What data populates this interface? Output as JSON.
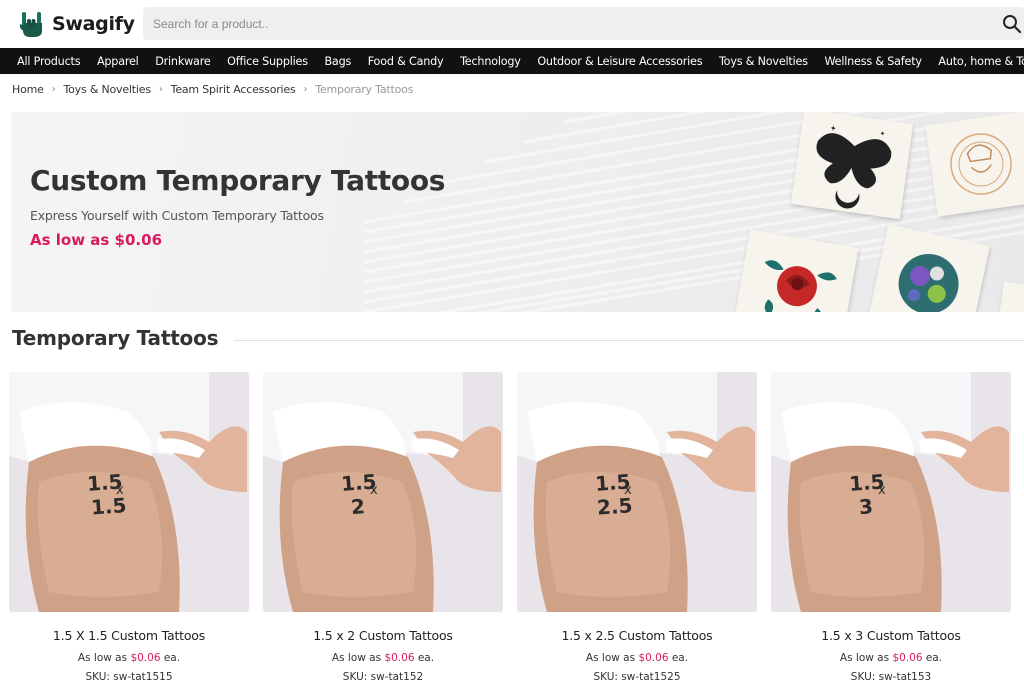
{
  "brand": {
    "name": "Swagify",
    "logo_icon": "hand-horns-icon"
  },
  "search": {
    "placeholder": "Search for a product..",
    "icon": "search-icon"
  },
  "nav": {
    "items": [
      "All Products",
      "Apparel",
      "Drinkware",
      "Office Supplies",
      "Bags",
      "Food & Candy",
      "Technology",
      "Outdoor & Leisure Accessories",
      "Toys & Novelties",
      "Wellness & Safety",
      "Auto, home & Tools"
    ]
  },
  "breadcrumb": {
    "items": [
      "Home",
      "Toys & Novelties",
      "Team Spirit Accessories"
    ],
    "current": "Temporary Tattoos",
    "separator": "›"
  },
  "hero": {
    "title": "Custom Temporary Tattoos",
    "subtitle": "Express Yourself with Custom Temporary Tattoos",
    "price": "As low as $0.06"
  },
  "section": {
    "title": "Temporary Tattoos"
  },
  "products": [
    {
      "name": "1.5 X 1.5 Custom Tattoos",
      "price_prefix": "As low as",
      "price": "$0.06",
      "price_suffix": "ea.",
      "sku": "SKU: sw-tat1515",
      "tattoo_top": "1.5",
      "tattoo_x": "x",
      "tattoo_bottom": "1.5"
    },
    {
      "name": "1.5 x 2 Custom Tattoos",
      "price_prefix": "As low as",
      "price": "$0.06",
      "price_suffix": "ea.",
      "sku": "SKU: sw-tat152",
      "tattoo_top": "1.5",
      "tattoo_x": "x",
      "tattoo_bottom": "2"
    },
    {
      "name": "1.5 x 2.5 Custom Tattoos",
      "price_prefix": "As low as",
      "price": "$0.06",
      "price_suffix": "ea.",
      "sku": "SKU: sw-tat1525",
      "tattoo_top": "1.5",
      "tattoo_x": "x",
      "tattoo_bottom": "2.5"
    },
    {
      "name": "1.5 x 3 Custom Tattoos",
      "price_prefix": "As low as",
      "price": "$0.06",
      "price_suffix": "ea.",
      "sku": "SKU: sw-tat153",
      "tattoo_top": "1.5",
      "tattoo_x": "x",
      "tattoo_bottom": "3"
    }
  ],
  "colors": {
    "accent": "#d81b60",
    "nav_bg": "#111111",
    "search_bg": "#eeeff0",
    "hero_bg": "#efeff0"
  }
}
